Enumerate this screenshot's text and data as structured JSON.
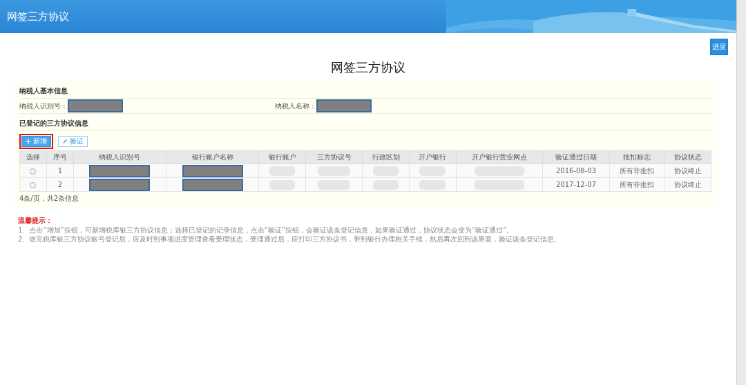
{
  "header": {
    "title": "网签三方协议"
  },
  "progress_button": {
    "label": "进度"
  },
  "page_title": "网签三方协议",
  "taxpayer_info": {
    "heading": "纳税人基本信息",
    "fields": [
      {
        "label": "纳税人识别号：",
        "redacted": true
      },
      {
        "label": "纳税人名称：",
        "redacted": true
      }
    ]
  },
  "agreements": {
    "heading": "已登记的三方协议信息",
    "buttons": [
      {
        "kind": "add",
        "label": "新增",
        "highlighted": true
      },
      {
        "kind": "verify",
        "label": "验证",
        "highlighted": false
      }
    ],
    "table": {
      "columns": [
        "选择",
        "序号",
        "纳税人识别号",
        "银行账户名称",
        "银行账户",
        "三方协议号",
        "行政区划",
        "开户银行",
        "开户银行营业网点",
        "验证通过日期",
        "批扣标志",
        "协议状态"
      ],
      "rows": [
        {
          "selected": false,
          "cells": [
            {
              "kind": "radio"
            },
            {
              "kind": "text",
              "text": "1"
            },
            {
              "kind": "redacted"
            },
            {
              "kind": "redacted"
            },
            {
              "kind": "blurred"
            },
            {
              "kind": "blurred"
            },
            {
              "kind": "blurred"
            },
            {
              "kind": "blurred"
            },
            {
              "kind": "blurred"
            },
            {
              "kind": "text",
              "text": "2016-08-03"
            },
            {
              "kind": "text",
              "text": "所有非批扣"
            },
            {
              "kind": "text",
              "text": "协议终止"
            }
          ]
        },
        {
          "selected": false,
          "cells": [
            {
              "kind": "radio"
            },
            {
              "kind": "text",
              "text": "2"
            },
            {
              "kind": "redacted"
            },
            {
              "kind": "redacted"
            },
            {
              "kind": "blurred"
            },
            {
              "kind": "blurred"
            },
            {
              "kind": "blurred"
            },
            {
              "kind": "blurred"
            },
            {
              "kind": "blurred"
            },
            {
              "kind": "text",
              "text": "2017-12-07"
            },
            {
              "kind": "text",
              "text": "所有非批扣"
            },
            {
              "kind": "text",
              "text": "协议终止"
            }
          ]
        }
      ]
    },
    "pagination": "4条/页，共2条信息"
  },
  "tips": {
    "title": "温馨提示：",
    "lines": [
      "1、点击“增加”按钮，可新增税库银三方协议信息；选择已登记的记录信息，点击“验证”按钮，会验证该条登记信息，如果验证通过，协议状态会变为“验证通过”。",
      "2、做完税库银三方协议账号登记后，应及时到事项进度管理查看受理状态，受理通过后，应打印三方协议书，带到银行办理相关手续，然后再次回到该界面，验证该条登记信息。"
    ]
  }
}
